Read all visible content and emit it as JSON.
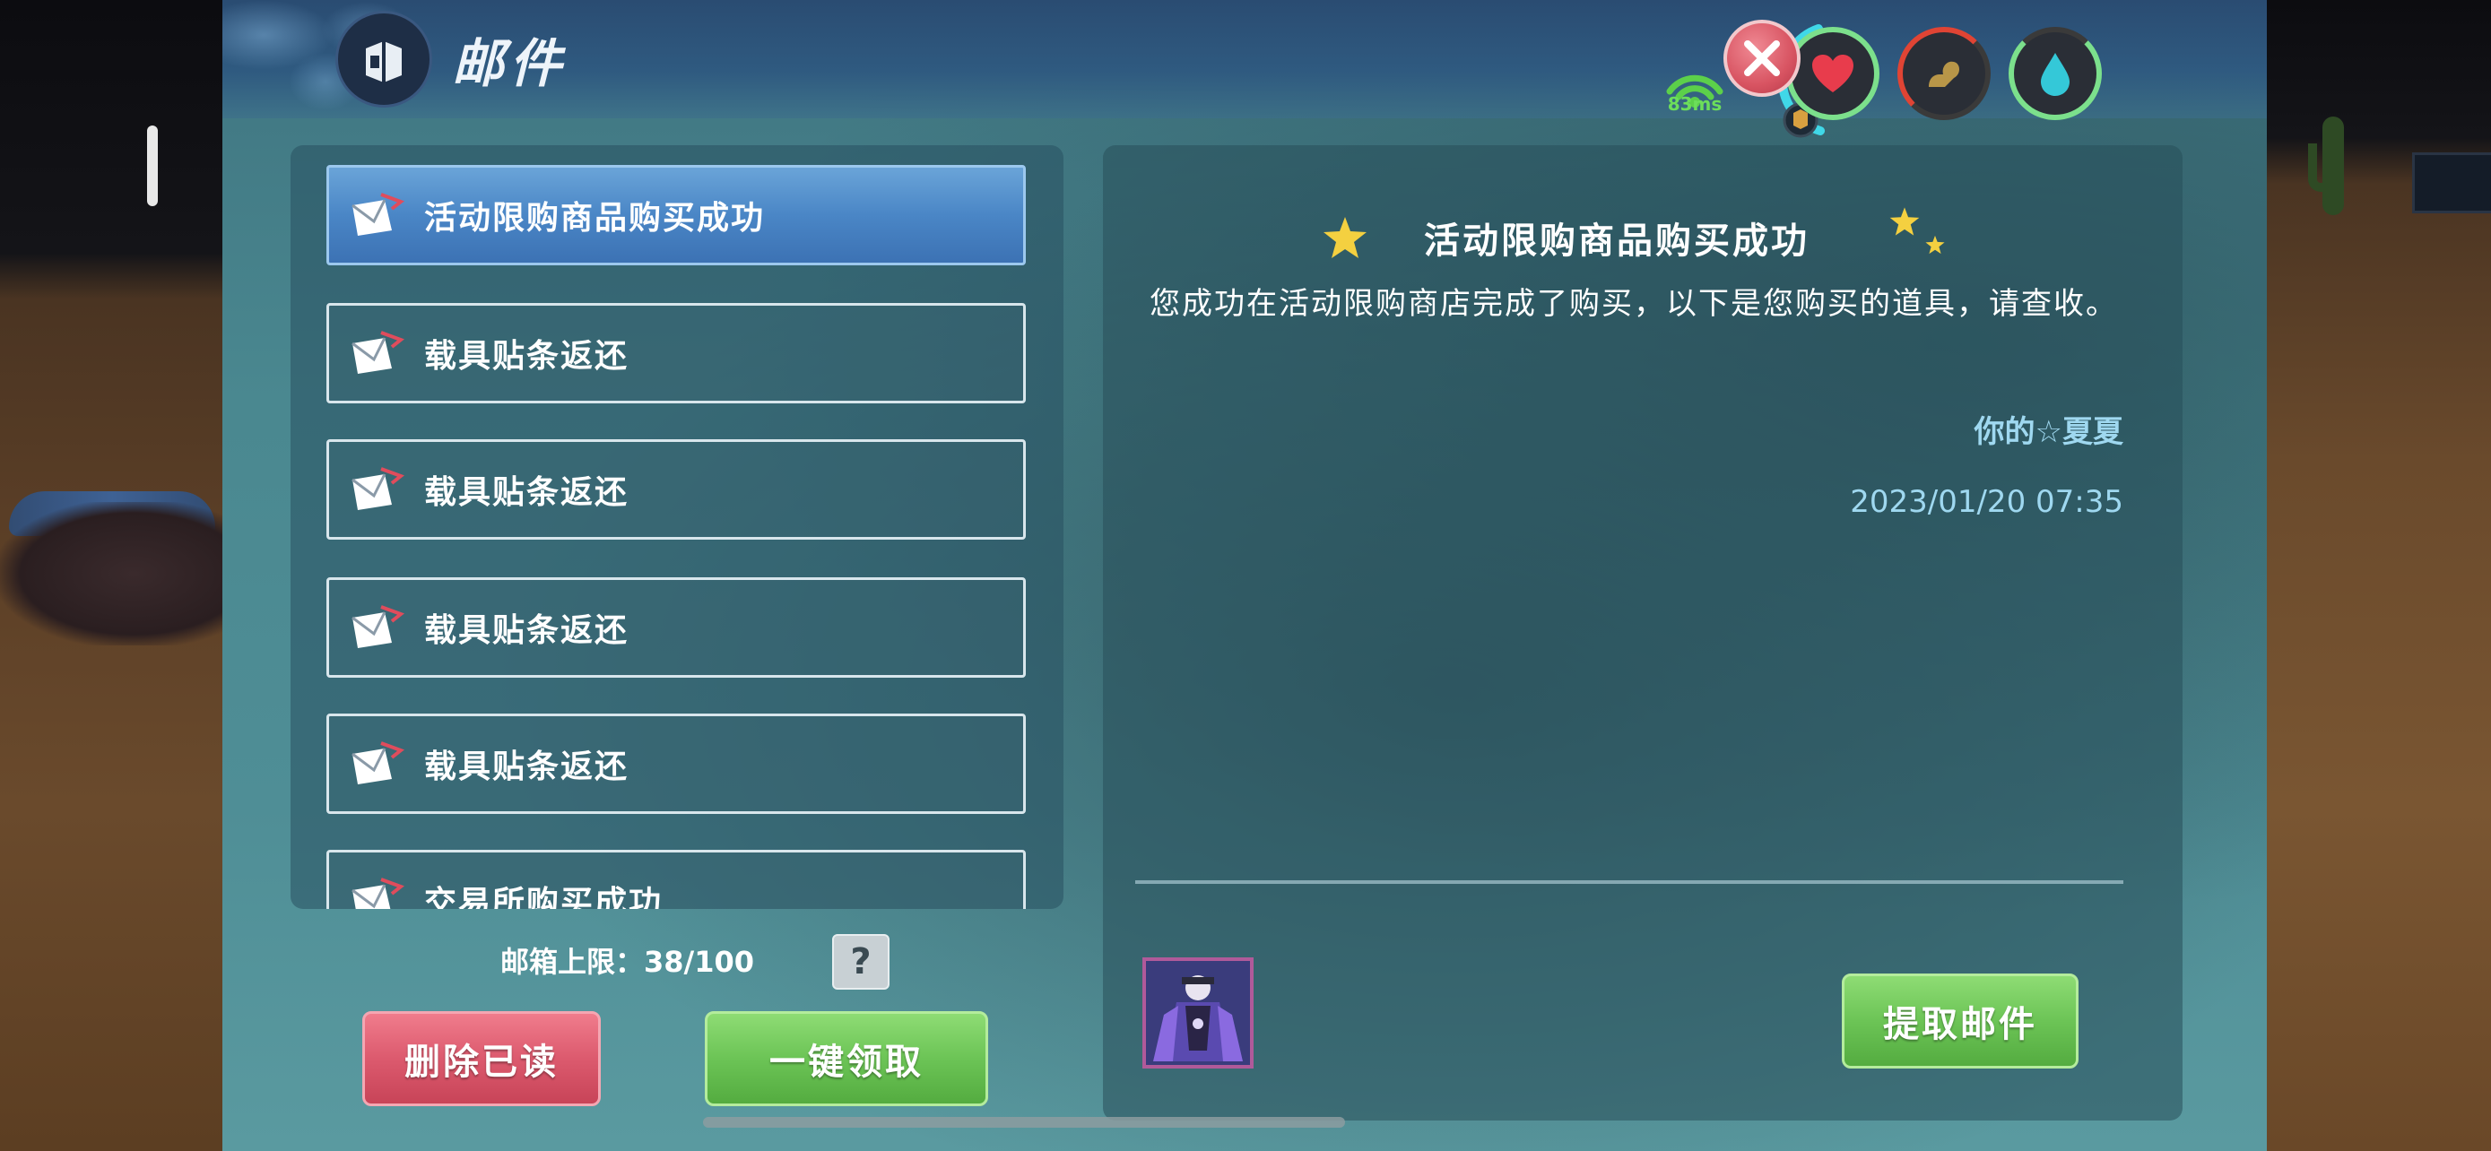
{
  "window": {
    "title": "邮件"
  },
  "network": {
    "ping": "83ms"
  },
  "stats": [
    {
      "name": "health",
      "icon": "heart-icon",
      "color": "#e83c4c",
      "ring": "#7ce08c"
    },
    {
      "name": "stamina",
      "icon": "arm-icon",
      "color": "#b89648",
      "ring": "#e04434"
    },
    {
      "name": "water",
      "icon": "droplet-icon",
      "color": "#34c8d8",
      "ring": "#7ce08c"
    }
  ],
  "mail_list": {
    "items": [
      {
        "label": "活动限购商品购买成功",
        "selected": true
      },
      {
        "label": "载具贴条返还",
        "selected": false
      },
      {
        "label": "载具贴条返还",
        "selected": false
      },
      {
        "label": "载具贴条返还",
        "selected": false
      },
      {
        "label": "载具贴条返还",
        "selected": false
      },
      {
        "label": "交易所购买成功",
        "selected": false
      }
    ],
    "capacity_label": "邮箱上限：38/100",
    "help_label": "?",
    "delete_read_label": "删除已读",
    "claim_all_label": "一键领取"
  },
  "detail": {
    "title": "活动限购商品购买成功",
    "body": "您成功在活动限购商店完成了购买，以下是您购买的道具，请查收。",
    "signature": "你的☆夏夏",
    "date": "2023/01/20 07:35",
    "claim_label": "提取邮件"
  },
  "colors": {
    "accent_blue": "#4a86c6",
    "button_red": "#dc5a6e",
    "button_green": "#6cc456",
    "date_text": "#9fd8f0"
  }
}
